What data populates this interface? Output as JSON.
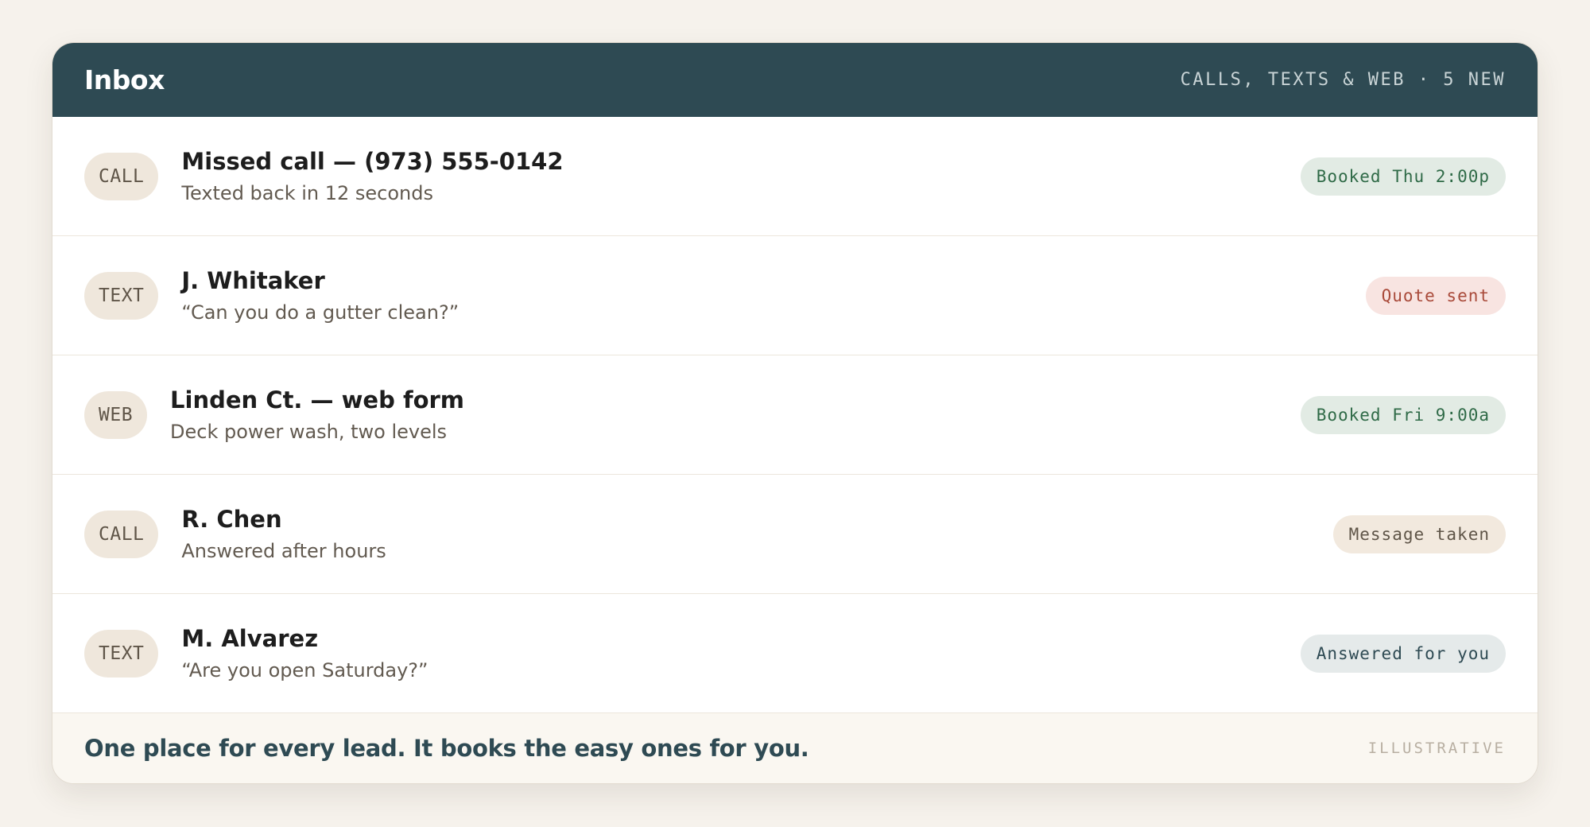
{
  "header": {
    "title": "Inbox",
    "subtitle": "CALLS, TEXTS & WEB · 5 NEW"
  },
  "rows": [
    {
      "channel": "CALL",
      "title": "Missed call — (973) 555-0142",
      "subtitle": "Texted back in 12 seconds",
      "status": "Booked Thu 2:00p"
    },
    {
      "channel": "TEXT",
      "title": "J. Whitaker",
      "subtitle": "“Can you do a gutter clean?”",
      "status": "Quote sent"
    },
    {
      "channel": "WEB",
      "title": "Linden Ct. — web form",
      "subtitle": "Deck power wash, two levels",
      "status": "Booked Fri 9:00a"
    },
    {
      "channel": "CALL",
      "title": "R. Chen",
      "subtitle": "Answered after hours",
      "status": "Message taken"
    },
    {
      "channel": "TEXT",
      "title": "M. Alvarez",
      "subtitle": "“Are you open Saturday?”",
      "status": "Answered for you"
    }
  ],
  "footer": {
    "tagline": "One place for every lead. It books the easy ones for you.",
    "note": "ILLUSTRATIVE"
  },
  "colors": {
    "header_bg": "#2e4a53",
    "page_bg": "#f6f2ec",
    "booked": "#2f6a47",
    "quote": "#a94a3a"
  }
}
